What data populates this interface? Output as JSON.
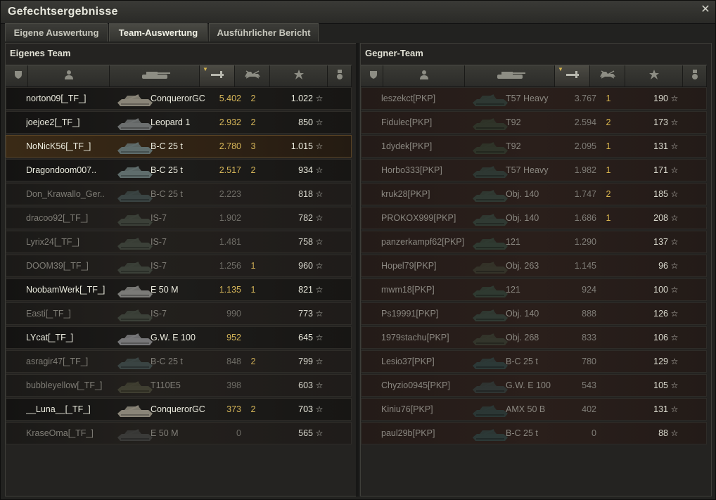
{
  "window": {
    "title": "Gefechtsergebnisse",
    "close_icon": "close-icon"
  },
  "tabs": [
    {
      "label": "Eigene Auswertung",
      "active": false
    },
    {
      "label": "Team-Auswertung",
      "active": true
    },
    {
      "label": "Ausführlicher Bericht",
      "active": false
    }
  ],
  "columns": [
    "shield-icon",
    "player-icon",
    "tank-icon",
    "damage-icon",
    "kills-icon",
    "star-icon",
    "medal-icon"
  ],
  "sorted_column": "damage",
  "own_team": {
    "title": "Eigenes Team",
    "rows": [
      {
        "name": "norton09[_TF_]",
        "tank": "ConquerorGC",
        "damage": "5.402",
        "kills": "2",
        "xp": "1.022",
        "state": "alive",
        "tank_color": "#8a8578"
      },
      {
        "name": "joejoe2[_TF_]",
        "tank": "Leopard 1",
        "damage": "2.932",
        "kills": "2",
        "xp": "850",
        "state": "alive",
        "tank_color": "#6c6f6f"
      },
      {
        "name": "NoNicK56[_TF_]",
        "tank": "B-C 25 t",
        "damage": "2.780",
        "kills": "3",
        "xp": "1.015",
        "state": "player",
        "tank_color": "#5f6d6c"
      },
      {
        "name": "Dragondoom007..",
        "tank": "B-C 25 t",
        "damage": "2.517",
        "kills": "2",
        "xp": "934",
        "state": "alive",
        "tank_color": "#5f6d6c"
      },
      {
        "name": "Don_Krawallo_Ger..",
        "tank": "B-C 25 t",
        "damage": "2.223",
        "kills": "",
        "xp": "818",
        "state": "dead",
        "tank_color": "#3a4443"
      },
      {
        "name": "dracoo92[_TF_]",
        "tank": "IS-7",
        "damage": "1.902",
        "kills": "",
        "xp": "782",
        "state": "dead",
        "tank_color": "#3b4038"
      },
      {
        "name": "Lyrix24[_TF_]",
        "tank": "IS-7",
        "damage": "1.481",
        "kills": "",
        "xp": "758",
        "state": "dead",
        "tank_color": "#3b4038"
      },
      {
        "name": "DOOM39[_TF_]",
        "tank": "IS-7",
        "damage": "1.256",
        "kills": "1",
        "xp": "960",
        "state": "dead",
        "tank_color": "#3b4038"
      },
      {
        "name": "NoobamWerk[_TF_]",
        "tank": "E 50 M",
        "damage": "1.135",
        "kills": "1",
        "xp": "821",
        "state": "alive",
        "tank_color": "#7b7b78"
      },
      {
        "name": "Easti[_TF_]",
        "tank": "IS-7",
        "damage": "990",
        "kills": "",
        "xp": "773",
        "state": "dead",
        "tank_color": "#3b4038"
      },
      {
        "name": "LYcat[_TF_]",
        "tank": "G.W. E 100",
        "damage": "952",
        "kills": "",
        "xp": "645",
        "state": "alive",
        "tank_color": "#777779"
      },
      {
        "name": "asragir47[_TF_]",
        "tank": "B-C 25 t",
        "damage": "848",
        "kills": "2",
        "xp": "799",
        "state": "dead",
        "tank_color": "#3a4443"
      },
      {
        "name": "bubbleyellow[_TF_]",
        "tank": "T110E5",
        "damage": "398",
        "kills": "",
        "xp": "603",
        "state": "dead",
        "tank_color": "#3f3e31"
      },
      {
        "name": "__Luna__[_TF_]",
        "tank": "ConquerorGC",
        "damage": "373",
        "kills": "2",
        "xp": "703",
        "state": "alive",
        "tank_color": "#8a8578"
      },
      {
        "name": "KraseOma[_TF_]",
        "tank": "E 50 M",
        "damage": "0",
        "kills": "",
        "xp": "565",
        "state": "dead",
        "tank_color": "#3a3a38"
      }
    ]
  },
  "enemy_team": {
    "title": "Gegner-Team",
    "rows": [
      {
        "name": "leszekct[PKP]",
        "tank": "T57 Heavy",
        "damage": "3.767",
        "kills": "1",
        "xp": "190",
        "tank_color": "#2e3833"
      },
      {
        "name": "Fidulec[PKP]",
        "tank": "T92",
        "damage": "2.594",
        "kills": "2",
        "xp": "173",
        "tank_color": "#2f3429"
      },
      {
        "name": "1dydek[PKP]",
        "tank": "T92",
        "damage": "2.095",
        "kills": "1",
        "xp": "131",
        "tank_color": "#2f3429"
      },
      {
        "name": "Horbo333[PKP]",
        "tank": "T57 Heavy",
        "damage": "1.982",
        "kills": "1",
        "xp": "171",
        "tank_color": "#2e3833"
      },
      {
        "name": "kruk28[PKP]",
        "tank": "Obj. 140",
        "damage": "1.747",
        "kills": "2",
        "xp": "185",
        "tank_color": "#303a33"
      },
      {
        "name": "PROKOX999[PKP]",
        "tank": "Obj. 140",
        "damage": "1.686",
        "kills": "1",
        "xp": "208",
        "tank_color": "#303a33"
      },
      {
        "name": "panzerkampf62[PKP]",
        "tank": "121",
        "damage": "1.290",
        "kills": "",
        "xp": "137",
        "tank_color": "#2f3a31"
      },
      {
        "name": "Hopel79[PKP]",
        "tank": "Obj. 263",
        "damage": "1.145",
        "kills": "",
        "xp": "96",
        "tank_color": "#343329"
      },
      {
        "name": "mwm18[PKP]",
        "tank": "121",
        "damage": "924",
        "kills": "",
        "xp": "100",
        "tank_color": "#2f3a31"
      },
      {
        "name": "Ps19991[PKP]",
        "tank": "Obj. 140",
        "damage": "888",
        "kills": "",
        "xp": "126",
        "tank_color": "#303a33"
      },
      {
        "name": "1979stachu[PKP]",
        "tank": "Obj. 268",
        "damage": "833",
        "kills": "",
        "xp": "106",
        "tank_color": "#33352b"
      },
      {
        "name": "Lesio37[PKP]",
        "tank": "B-C 25 t",
        "damage": "780",
        "kills": "",
        "xp": "129",
        "tank_color": "#2c3937"
      },
      {
        "name": "Chyzio0945[PKP]",
        "tank": "G.W. E 100",
        "damage": "543",
        "kills": "",
        "xp": "105",
        "tank_color": "#2f3533"
      },
      {
        "name": "Kiniu76[PKP]",
        "tank": "AMX 50 B",
        "damage": "402",
        "kills": "",
        "xp": "131",
        "tank_color": "#2b3735"
      },
      {
        "name": "paul29b[PKP]",
        "tank": "B-C 25 t",
        "damage": "0",
        "kills": "",
        "xp": "88",
        "tank_color": "#2c3937"
      }
    ]
  }
}
